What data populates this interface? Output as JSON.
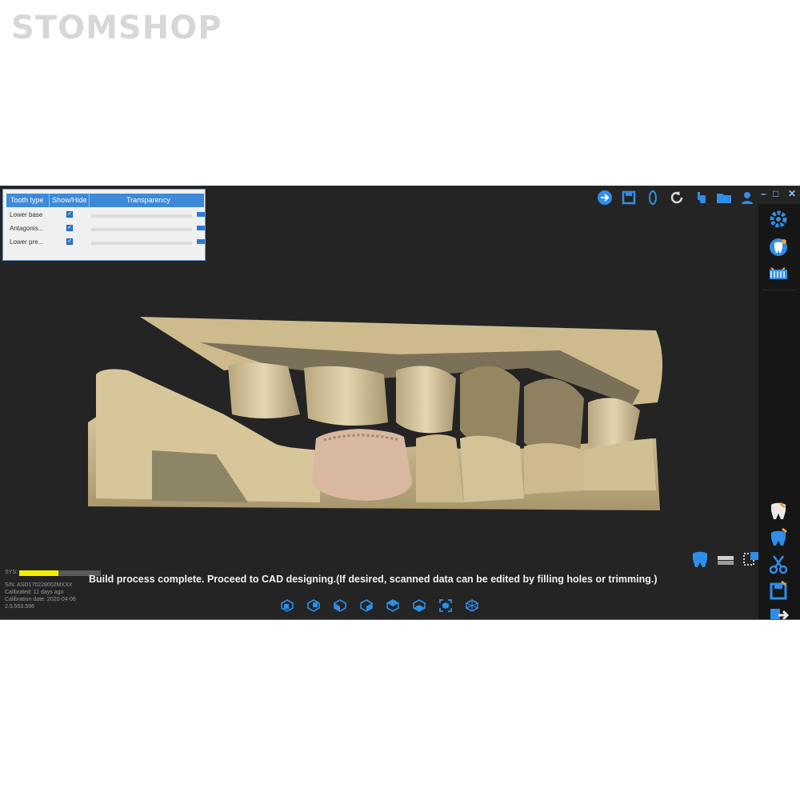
{
  "watermark": "STOMSHOP",
  "panel": {
    "headers": [
      "Tooth type",
      "Show/Hide",
      "Transparency"
    ],
    "rows": [
      {
        "name": "Lower base",
        "shown": true,
        "transparency": 0
      },
      {
        "name": "Antagonis...",
        "shown": true,
        "transparency": 0
      },
      {
        "name": "Lower pre...",
        "shown": true,
        "transparency": 0
      }
    ]
  },
  "toolbar": {
    "icons": [
      "upload-icon",
      "save-icon",
      "oval-icon",
      "refresh-icon",
      "hand-icon",
      "folder-icon",
      "user-icon"
    ],
    "window_buttons": [
      "–",
      "□",
      "✕"
    ]
  },
  "sidebar": {
    "top_icons": [
      "settings-gear-icon",
      "tooth-info-icon",
      "dental-arch-icon"
    ],
    "bottom_icons": [
      "tooth-crown-icon",
      "tooth-edit-icon",
      "scissors-trim-icon",
      "save-export-icon",
      "send-next-icon"
    ]
  },
  "status": {
    "sys_label": "SYS:",
    "progress": 0.48,
    "serial": "S/N: ASD170228002MXXX",
    "calibrated": "Calibrated: 11 days ago",
    "calibration_date": "Calibration date: 2020-04-06",
    "version": "2.5.553.596",
    "message": "Build process complete. Proceed to CAD designing.(If desired, scanned data can be edited by filling holes or trimming.)"
  },
  "view_buttons": [
    "view-front-icon",
    "view-back-icon",
    "view-left-icon",
    "view-right-icon",
    "view-top-icon",
    "view-bottom-icon",
    "view-fit-icon",
    "view-iso-icon"
  ],
  "tool_buttons": [
    "tooth-select-icon",
    "bite-align-icon",
    "trim-mesh-icon"
  ],
  "colors": {
    "accent": "#2f8ee8",
    "background": "#242424",
    "progress": "#f2ef00",
    "model": "#c7b48a"
  }
}
